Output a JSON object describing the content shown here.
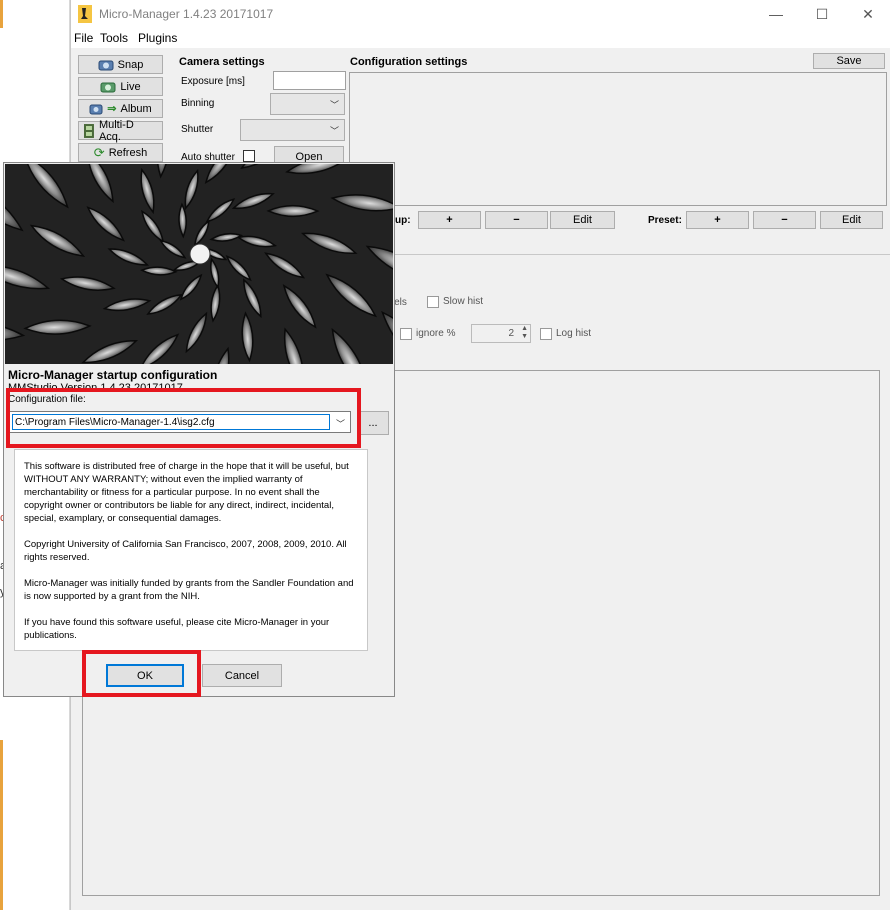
{
  "window": {
    "title": "Micro-Manager 1.4.23 20171017"
  },
  "menu": {
    "items": [
      "File",
      "Tools",
      "Plugins"
    ]
  },
  "toolbar": {
    "snap": "Snap",
    "live": "Live",
    "album": "Album",
    "multid": "Multi-D Acq.",
    "refresh": "Refresh"
  },
  "camera": {
    "heading": "Camera settings",
    "exposure_label": "Exposure [ms]",
    "exposure_value": "",
    "binning_label": "Binning",
    "shutter_label": "Shutter",
    "auto_shutter_label": "Auto shutter",
    "open_button": "Open"
  },
  "config": {
    "heading": "Configuration settings",
    "save_button": "Save",
    "group_label_partial": "up:",
    "preset_label": "Preset:",
    "plus": "+",
    "minus": "−",
    "edit": "Edit"
  },
  "histogram": {
    "channels_partial": "nnels",
    "slow_hist": "Slow hist",
    "ignore_pct": "ignore %",
    "ignore_value": "2",
    "log_hist": "Log hist"
  },
  "dialog": {
    "title": "Micro-Manager startup configuration",
    "version": "MMStudio Version 1.4.23 20171017",
    "config_file_label": "Configuration file:",
    "config_file_value": "C:\\Program Files\\Micro-Manager-1.4\\isg2.cfg",
    "browse_button": "...",
    "license": [
      "This software is distributed free of charge in the hope that it will be useful, but WITHOUT ANY WARRANTY; without even the implied warranty of merchantability or fitness for a particular purpose. In no event shall the copyright owner or contributors be liable for any direct, indirect, incidental, special, examplary, or consequential damages.",
      "Copyright University of California San Francisco, 2007, 2008, 2009, 2010. All rights reserved.",
      "Micro-Manager was initially funded by grants from the Sandler Foundation and is now supported by a grant from the NIH.",
      "If you have found this software useful, please cite Micro-Manager in your publications."
    ],
    "ok_button": "OK",
    "cancel_button": "Cancel"
  },
  "background_window": {
    "glyphs": [
      "c",
      "a",
      "y"
    ]
  },
  "colors": {
    "highlight": "#e5171f",
    "accent": "#0078d7"
  }
}
